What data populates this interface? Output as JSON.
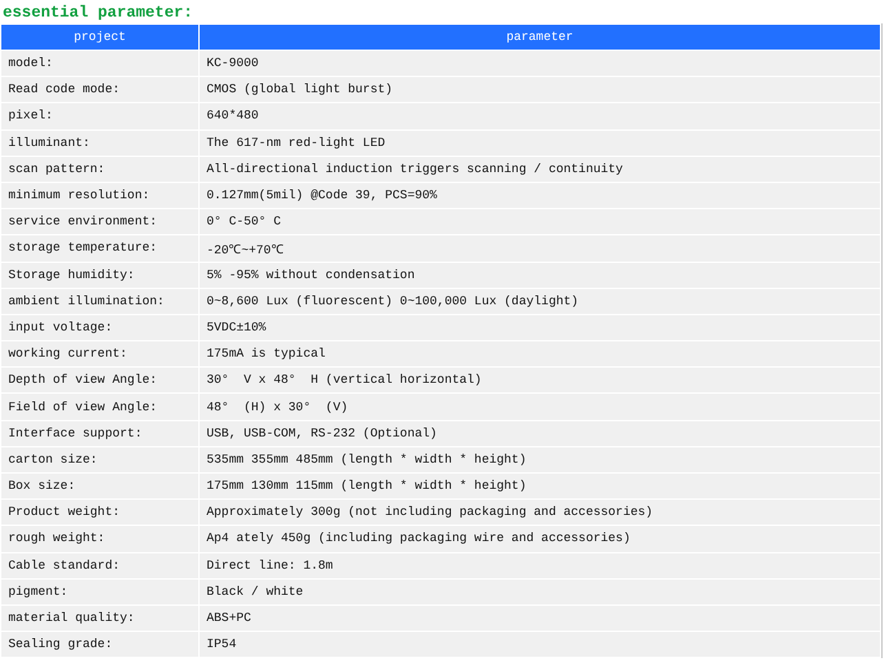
{
  "title": "essential parameter:",
  "table": {
    "columns": [
      "project",
      "parameter"
    ],
    "rows": [
      [
        "model:",
        "KC-9000"
      ],
      [
        "Read code mode:",
        "CMOS (global light burst)"
      ],
      [
        "pixel:",
        "640*480"
      ],
      [
        "illuminant:",
        "The 617-nm red-light LED"
      ],
      [
        "scan pattern:",
        "All-directional induction triggers scanning / continuity"
      ],
      [
        "minimum resolution:",
        "0.127mm(5mil) @Code 39, PCS=90%"
      ],
      [
        "service environment:",
        "0° C-50° C"
      ],
      [
        "storage temperature:",
        "-20℃~+70℃"
      ],
      [
        "Storage humidity:",
        "5% -95% without condensation"
      ],
      [
        "ambient illumination:",
        "0~8,600 Lux (fluorescent) 0~100,000 Lux (daylight)"
      ],
      [
        "input voltage:",
        "5VDC±10%"
      ],
      [
        "working current:",
        "175mA is typical"
      ],
      [
        "Depth of view Angle:",
        "30°  V x 48°  H (vertical horizontal)"
      ],
      [
        "Field of view Angle:",
        "48°  (H) x 30°  (V)"
      ],
      [
        "Interface support:",
        "USB, USB-COM, RS-232 (Optional)"
      ],
      [
        "carton size:",
        "535mm 355mm 485mm (length * width * height)"
      ],
      [
        "Box size:",
        "175mm 130mm 115mm (length * width * height)"
      ],
      [
        "Product weight:",
        "Approximately 300g (not including packaging and accessories)"
      ],
      [
        "rough weight:",
        "Ap4 ately 450g (including packaging wire and accessories)"
      ],
      [
        "Cable standard:",
        "Direct line: 1.8m"
      ],
      [
        "pigment:",
        "Black / white"
      ],
      [
        "material quality:",
        "ABS+PC"
      ],
      [
        "Sealing grade:",
        "IP54"
      ]
    ]
  }
}
